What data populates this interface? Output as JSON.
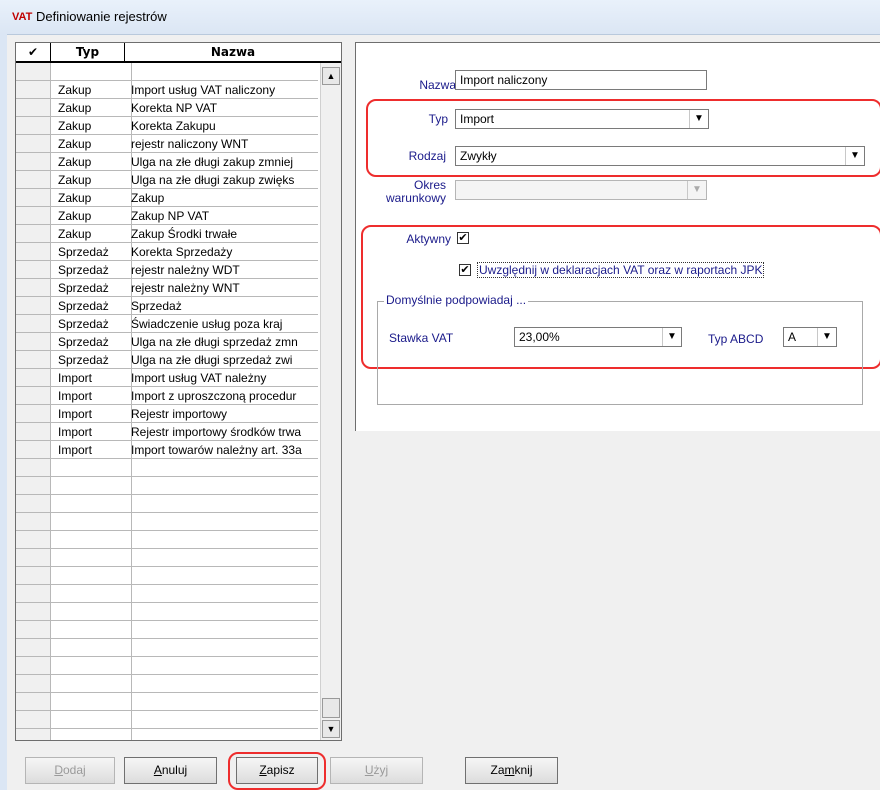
{
  "window": {
    "title": "Definiowanie rejestrów",
    "icon_text": "VAT"
  },
  "grid": {
    "headers": {
      "check": "✔",
      "typ": "Typ",
      "nazwa": "Nazwa"
    },
    "rows": [
      {
        "typ": "",
        "nazwa": ""
      },
      {
        "typ": "Zakup",
        "nazwa": "Import usług VAT naliczony"
      },
      {
        "typ": "Zakup",
        "nazwa": "Korekta NP VAT"
      },
      {
        "typ": "Zakup",
        "nazwa": "Korekta Zakupu"
      },
      {
        "typ": "Zakup",
        "nazwa": "rejestr naliczony WNT"
      },
      {
        "typ": "Zakup",
        "nazwa": "Ulga na złe długi zakup zmniej"
      },
      {
        "typ": "Zakup",
        "nazwa": "Ulga na złe długi zakup zwięks"
      },
      {
        "typ": "Zakup",
        "nazwa": "Zakup"
      },
      {
        "typ": "Zakup",
        "nazwa": "Zakup NP VAT"
      },
      {
        "typ": "Zakup",
        "nazwa": "Zakup Środki trwałe"
      },
      {
        "typ": "Sprzedaż",
        "nazwa": "Korekta Sprzedaży"
      },
      {
        "typ": "Sprzedaż",
        "nazwa": "rejestr należny WDT"
      },
      {
        "typ": "Sprzedaż",
        "nazwa": "rejestr należny WNT"
      },
      {
        "typ": "Sprzedaż",
        "nazwa": "Sprzedaż"
      },
      {
        "typ": "Sprzedaż",
        "nazwa": "Świadczenie usług poza kraj"
      },
      {
        "typ": "Sprzedaż",
        "nazwa": "Ulga na złe długi sprzedaż zmn"
      },
      {
        "typ": "Sprzedaż",
        "nazwa": "Ulga na złe długi sprzedaż zwi"
      },
      {
        "typ": "Import",
        "nazwa": "Import usług VAT należny"
      },
      {
        "typ": "Import",
        "nazwa": "Import z uproszczoną procedur"
      },
      {
        "typ": "Import",
        "nazwa": "Rejestr importowy"
      },
      {
        "typ": "Import",
        "nazwa": "Rejestr importowy środków trwa"
      },
      {
        "typ": "Import",
        "nazwa": "Import towarów należny art. 33a"
      }
    ],
    "empty_rows": 17,
    "selected_row_index": 21
  },
  "form": {
    "nazwa": {
      "label": "Nazwa",
      "value": "Import  naliczony"
    },
    "typ": {
      "label": "Typ",
      "value": "Import"
    },
    "rodzaj": {
      "label": "Rodzaj",
      "value": "Zwykły"
    },
    "okres": {
      "label_line1": "Okres",
      "label_line2": "warunkowy",
      "value": ""
    },
    "aktywny": {
      "label": "Aktywny",
      "checked": true
    },
    "uwzglednij": {
      "label": "Uwzględnij w deklaracjach VAT oraz w raportach JPK",
      "checked": true
    },
    "group_title": "Domyślnie podpowiadaj ...",
    "stawka": {
      "label": "Stawka VAT",
      "value": "23,00%"
    },
    "typ_abcd": {
      "label": "Typ ABCD",
      "value": "A"
    }
  },
  "buttons": {
    "dodaj": {
      "pre": "",
      "key": "D",
      "post": "odaj",
      "enabled": false
    },
    "anuluj": {
      "pre": "",
      "key": "A",
      "post": "nuluj",
      "enabled": true
    },
    "zapisz": {
      "pre": "",
      "key": "Z",
      "post": "apisz",
      "enabled": true
    },
    "uzyj": {
      "pre": "",
      "key": "U",
      "post": "żyj",
      "enabled": false
    },
    "zamknij": {
      "pre": "Za",
      "key": "m",
      "post": "knij",
      "enabled": true
    }
  },
  "colors": {
    "highlight_border": "#ee2d2d",
    "label_text": "#1a1a8a"
  }
}
